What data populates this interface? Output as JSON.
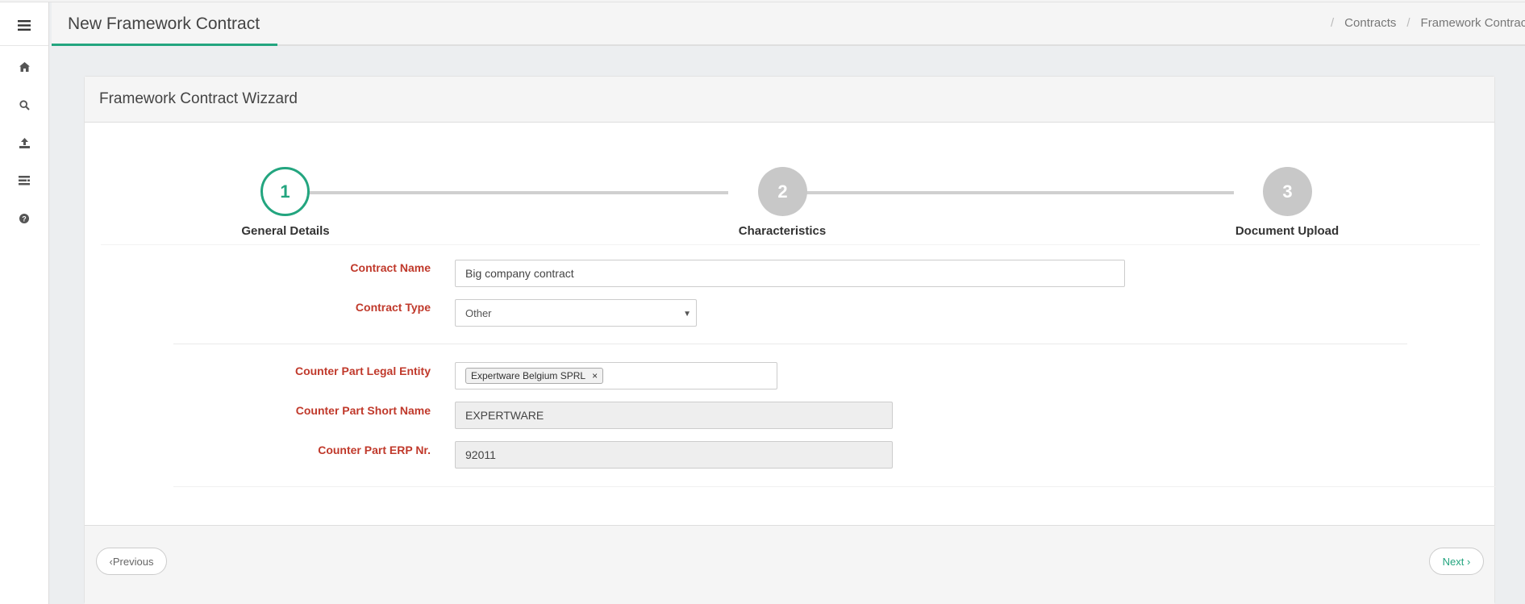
{
  "header": {
    "title": "New Framework Contract",
    "breadcrumb": [
      "Contracts",
      "Framework Contract"
    ]
  },
  "sidebar": {
    "items": [
      {
        "icon": "home-icon"
      },
      {
        "icon": "search-icon"
      },
      {
        "icon": "upload-icon"
      },
      {
        "icon": "list-icon"
      },
      {
        "icon": "help-icon"
      }
    ]
  },
  "panel": {
    "title": "Framework Contract Wizzard"
  },
  "wizard": {
    "steps": [
      {
        "number": "1",
        "label": "General Details",
        "active": true
      },
      {
        "number": "2",
        "label": "Characteristics",
        "active": false
      },
      {
        "number": "3",
        "label": "Document Upload",
        "active": false
      }
    ]
  },
  "form": {
    "contract_name": {
      "label": "Contract Name",
      "value": "Big company contract"
    },
    "contract_type": {
      "label": "Contract Type",
      "value": "Other"
    },
    "counter_part_legal_entity": {
      "label": "Counter Part Legal Entity",
      "tag": "Expertware Belgium SPRL",
      "remove": "×"
    },
    "counter_part_short_name": {
      "label": "Counter Part Short Name",
      "value": "EXPERTWARE"
    },
    "counter_part_erp": {
      "label": "Counter Part ERP Nr.",
      "value": "92011"
    }
  },
  "footer": {
    "previous_label": "‹Previous",
    "next_label": "Next ›"
  },
  "colors": {
    "accent": "#23a57f",
    "required_label": "#c0392b",
    "inactive_step": "#c8c8c8"
  }
}
